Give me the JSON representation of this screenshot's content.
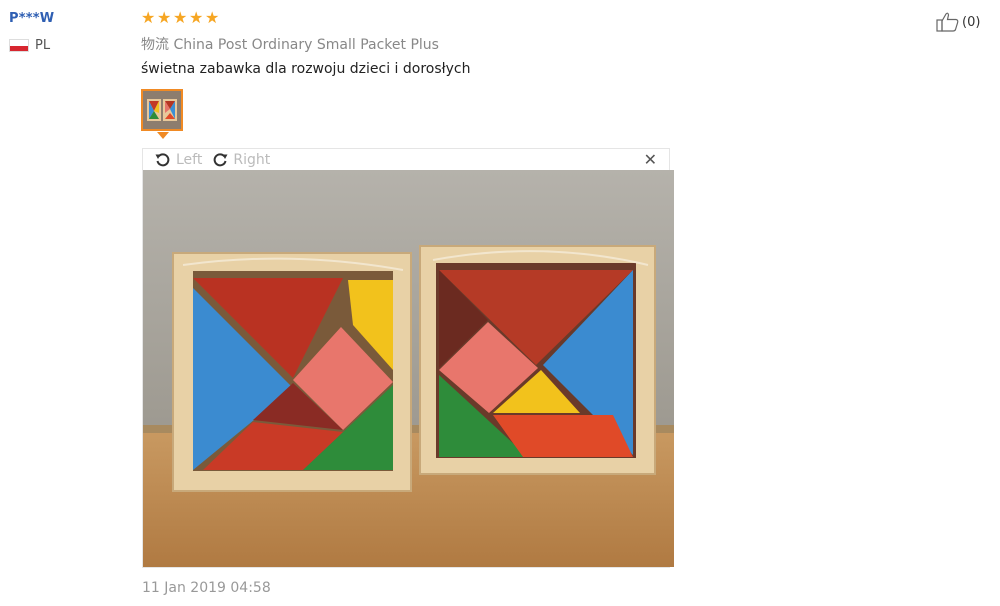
{
  "reviewer": {
    "name": "P***W",
    "country": "PL"
  },
  "rating": 5,
  "shipping_label": "物流 China Post Ordinary Small Packet Plus",
  "review_text": "świetna zabawka dla rozwoju dzieci i dorosłych",
  "viewer": {
    "rotate_left_label": "Left",
    "rotate_right_label": "Right"
  },
  "date": "11 Jan 2019 04:58",
  "helpful": {
    "count_label": "(0)"
  },
  "icons": {
    "star": "star-icon",
    "flag": "poland-flag-icon",
    "rotate_left": "rotate-left-icon",
    "rotate_right": "rotate-right-icon",
    "close": "close-icon",
    "thumbs_up": "thumbs-up-icon"
  },
  "colors": {
    "user_name": "#2f5fb3",
    "star": "#f6a623",
    "thumb_border": "#f08a24"
  }
}
